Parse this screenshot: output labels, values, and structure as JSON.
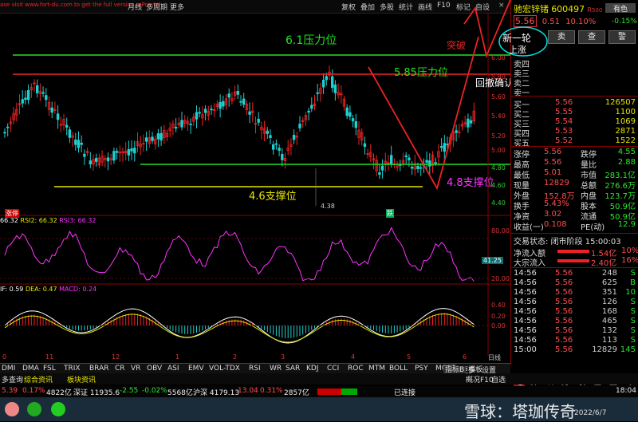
{
  "promo_text": "ase visit www.fort-du.com to get the full version.e-Pointel",
  "toolbar": {
    "items": [
      "月线",
      "多周期",
      "更多"
    ],
    "right_items": [
      "复权",
      "叠加",
      "多股",
      "统计",
      "画线",
      "F10",
      "标记",
      "自设"
    ],
    "close": "×"
  },
  "price_axis": [
    "6.00",
    "5.80",
    "5.60",
    "5.40",
    "5.20",
    "5.00",
    "4.80",
    "4.60",
    "4.40"
  ],
  "annotations": {
    "resist_61": "6.1压力位",
    "resist_585": "5.85压力位",
    "support_46": "4.6支撑位",
    "support_48": "4.8支撑位",
    "breakout": "突破",
    "new_round": "新一轮",
    "rise": "上涨",
    "pullback": "回撤确认",
    "low_mark": "4.38",
    "limit_up": "涨停",
    "fall_tag": "跌"
  },
  "rsi": {
    "label_a": "66.32",
    "label_b": "RSI2: 66.32",
    "label_c": "RSI3: 66.32",
    "axis_top": "80.00",
    "axis_mid": "20.00",
    "current": "41.25"
  },
  "macd": {
    "label_a": "IF: 0.59",
    "label_b": "DEA: 0.47",
    "label_c": "MACD: 0.24",
    "axis": [
      "0.40",
      "0.20",
      "0.00"
    ]
  },
  "x_axis": [
    "0",
    "11",
    "12",
    "1",
    "2",
    "3",
    "4",
    "5",
    "6"
  ],
  "x_axis_extra": "日线",
  "stock": {
    "name": "驰宏锌锗",
    "code": "600497",
    "r_label": "R",
    "r_value": "500",
    "price": "5.56",
    "change": "0.51",
    "pct": "10.10%",
    "tag": "有色",
    "tag_pct": "-0.15%"
  },
  "buttons": {
    "buy": "买",
    "sell": "卖",
    "view": "查",
    "alert": "警"
  },
  "order_book": {
    "asks": [
      {
        "label": "卖五",
        "price": "",
        "vol": ""
      },
      {
        "label": "卖四",
        "price": "",
        "vol": ""
      },
      {
        "label": "卖三",
        "price": "",
        "vol": ""
      },
      {
        "label": "卖二",
        "price": "",
        "vol": ""
      },
      {
        "label": "卖一",
        "price": "",
        "vol": ""
      }
    ],
    "bids": [
      {
        "label": "买一",
        "price": "5.56",
        "vol": "126507"
      },
      {
        "label": "买二",
        "price": "5.55",
        "vol": "1100"
      },
      {
        "label": "买三",
        "price": "5.54",
        "vol": "1069"
      },
      {
        "label": "买四",
        "price": "5.53",
        "vol": "2871"
      },
      {
        "label": "买五",
        "price": "5.52",
        "vol": "1522"
      }
    ]
  },
  "quote": [
    {
      "l1": "涨停",
      "v1": "5.56",
      "l2": "跌停",
      "v2": "4.55"
    },
    {
      "l1": "最高",
      "v1": "5.56",
      "l2": "量比",
      "v2": "2.88"
    },
    {
      "l1": "最低",
      "v1": "5.01",
      "l2": "市值",
      "v2": "283.1亿"
    },
    {
      "l1": "现量",
      "v1": "12829",
      "l2": "总额",
      "v2": "276.6万"
    },
    {
      "l1": "外盘",
      "v1": "152.8万",
      "l2": "内盘",
      "v2": "123.7万"
    },
    {
      "l1": "换手",
      "v1": "5.43%",
      "l2": "股本",
      "v2": "50.9亿"
    },
    {
      "l1": "净资",
      "v1": "3.02",
      "l2": "流通",
      "v2": "50.9亿"
    },
    {
      "l1": "收益(一)",
      "v1": "0.108",
      "l2": "PE(动)",
      "v2": "12.9"
    }
  ],
  "stage": {
    "title": "交易状态: 闭市阶段 15:00:03",
    "inflow_label": "净流入额",
    "inflow_value": "1.54亿",
    "inflow_pct": "10%",
    "big_label": "大宗流入",
    "big_value": "2.40亿",
    "big_pct": "16%"
  },
  "ticks": [
    {
      "t": "14:56",
      "p": "5.56",
      "v": "248",
      "f": "S"
    },
    {
      "t": "14:56",
      "p": "5.56",
      "v": "625",
      "f": "B"
    },
    {
      "t": "14:56",
      "p": "5.56",
      "v": "351",
      "f": "10"
    },
    {
      "t": "14:56",
      "p": "5.56",
      "v": "126",
      "f": "S"
    },
    {
      "t": "14:56",
      "p": "5.56",
      "v": "168",
      "f": "S"
    },
    {
      "t": "14:56",
      "p": "5.56",
      "v": "465",
      "f": "S"
    },
    {
      "t": "14:56",
      "p": "5.56",
      "v": "132",
      "f": "S"
    },
    {
      "t": "14:56",
      "p": "5.56",
      "v": "113",
      "f": "S"
    },
    {
      "t": "15:00",
      "p": "5.56",
      "v": "12829",
      "f": "145"
    }
  ],
  "indicator_tabs": [
    "DMI",
    "DMA",
    "FSL",
    "TRIX",
    "BRAR",
    "CR",
    "VR",
    "OBV",
    "ASI",
    "EMV",
    "VOL-TDX",
    "RSI",
    "WR",
    "SAR",
    "KDJ",
    "CCI",
    "ROC",
    "MTM",
    "BOLL",
    "PSY",
    "MCST",
    "更多",
    "设置"
  ],
  "indicator_right": [
    "指标B",
    "模板"
  ],
  "sub_tabs": [
    "多查询",
    "综合资讯",
    "板块资讯"
  ],
  "sub_right": [
    "概况F10",
    "自选"
  ],
  "right_bottom_tabs": [
    "笔",
    "价",
    "细",
    "势",
    "联",
    "值",
    "主",
    "筹"
  ],
  "status_bar": {
    "i1": "5.39",
    "i2": "0.17%",
    "i3": "4822亿",
    "i4": "深证 11935.6",
    "i5": "-2.55",
    "i6": "-0.02%",
    "i7": "5568亿",
    "i8": "沪深 4179.13",
    "i9": "13.04",
    "i10": "0.31%",
    "i11": "2857亿",
    "i12": "已连接",
    "time": "18:04"
  },
  "watermark": "雪球：塔珈传奇",
  "date": "2022/6/7"
}
